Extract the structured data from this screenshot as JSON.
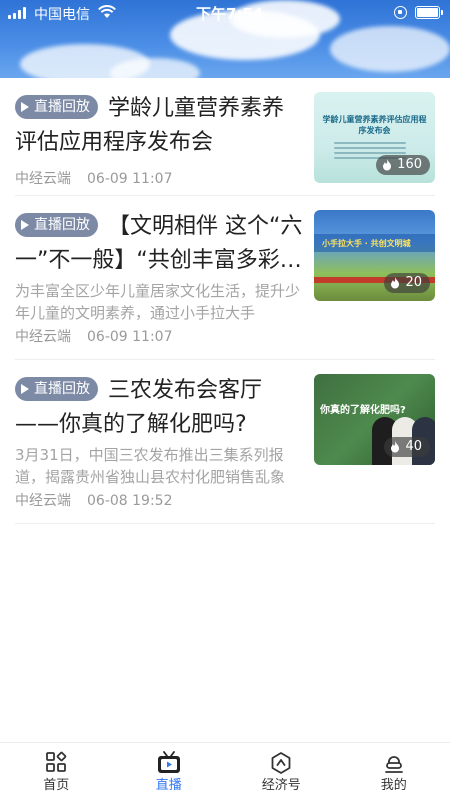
{
  "status_bar": {
    "carrier": "中国电信",
    "time": "下午7:54"
  },
  "items": [
    {
      "badge": "直播回放",
      "title": "学龄儿童营养素养评估应用程序发布会",
      "summary": "",
      "source": "中经云端",
      "date": "06-09 11:07",
      "heat": "160",
      "thumb_text": "学龄儿童营养素养评估应用程序发布会"
    },
    {
      "badge": "直播回放",
      "title": "【文明相伴 这个“六一”不一般】“共创丰富多彩的文明",
      "summary": "为丰富全区少年儿童居家文化生活，提升少年儿童的文明素养，通过小手拉大手",
      "source": "中经云端",
      "date": "06-09 11:07",
      "heat": "20",
      "thumb_text": "小手拉大手 · 共创文明城"
    },
    {
      "badge": "直播回放",
      "title": "三农发布会客厅——你真的了解化肥吗?",
      "summary": "3月31日，中国三农发布推出三集系列报道，揭露贵州省独山县农村化肥销售乱象",
      "source": "中经云端",
      "date": "06-08 19:52",
      "heat": "40",
      "thumb_text": "你真的了解化肥吗?"
    }
  ],
  "tabs": [
    {
      "label": "首页",
      "icon": "grid-icon",
      "active": false
    },
    {
      "label": "直播",
      "icon": "tv-icon",
      "active": true
    },
    {
      "label": "经济号",
      "icon": "hexagon-icon",
      "active": false
    },
    {
      "label": "我的",
      "icon": "user-icon",
      "active": false
    }
  ],
  "colors": {
    "accent": "#3478f6",
    "badge_bg": "#7d8aa6"
  }
}
